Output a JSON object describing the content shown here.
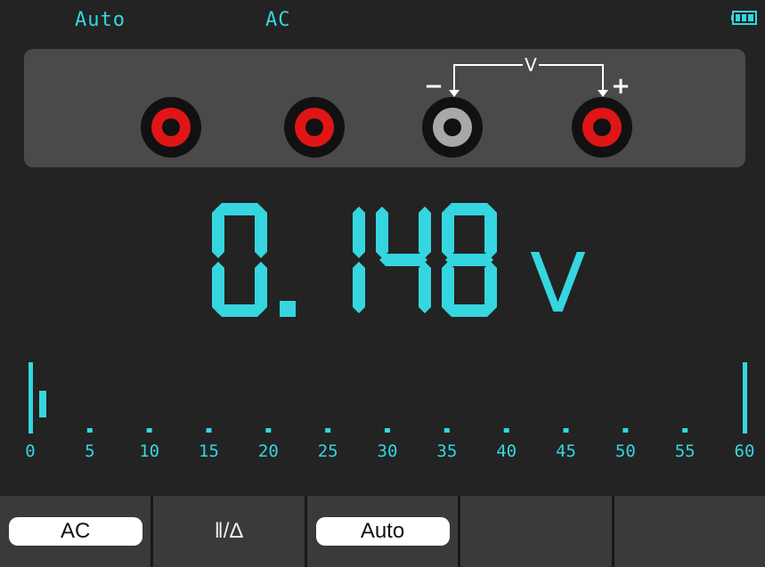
{
  "status": {
    "range_mode": "Auto",
    "coupling": "AC",
    "battery_icon": "battery-full-icon"
  },
  "probes": {
    "jacks": [
      {
        "role": "terminal-1",
        "color": "#e01616"
      },
      {
        "role": "terminal-2",
        "color": "#e01616"
      },
      {
        "role": "com",
        "color": "#a8a8a8"
      },
      {
        "role": "v-terminal",
        "color": "#e01616"
      }
    ],
    "wiring_label": "V",
    "negative_sign": "−",
    "positive_sign": "+"
  },
  "reading": {
    "value": "0.148",
    "unit": "V"
  },
  "bargraph": {
    "scale_labels": [
      "0",
      "5",
      "10",
      "15",
      "20",
      "25",
      "30",
      "35",
      "40",
      "45",
      "50",
      "55",
      "60"
    ],
    "level": 0.148,
    "scale_max": 60
  },
  "softkeys": [
    {
      "label": "AC",
      "style": "selected"
    },
    {
      "label": "‖/Δ",
      "style": "plain"
    },
    {
      "label": "Auto",
      "style": "selected"
    },
    {
      "label": "",
      "style": "plain"
    },
    {
      "label": "",
      "style": "plain"
    }
  ],
  "colors": {
    "accent": "#35d6e0",
    "background": "#232323",
    "panel": "#4a4a4a",
    "jack_red": "#e01616",
    "jack_com": "#a8a8a8"
  }
}
